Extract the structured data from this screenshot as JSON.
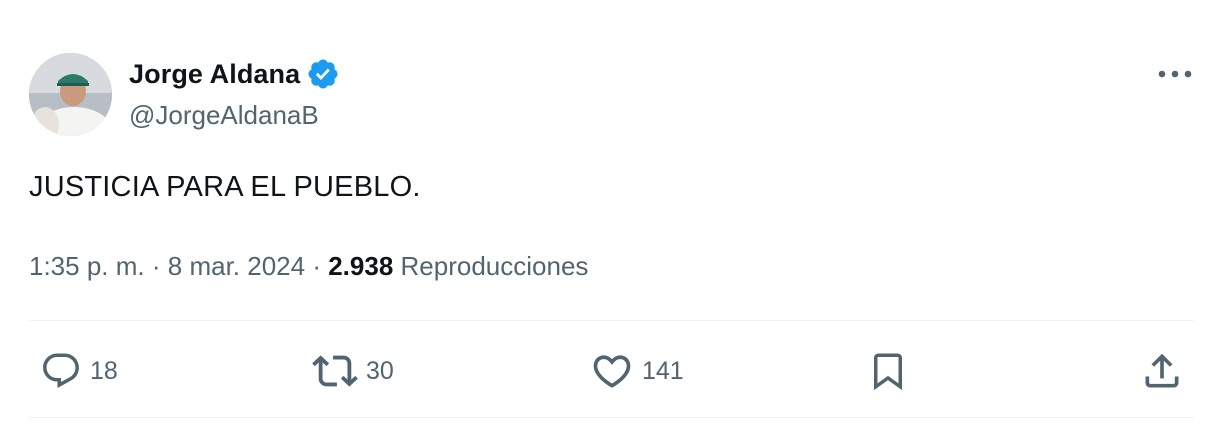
{
  "author": {
    "name": "Jorge Aldana",
    "handle": "@JorgeAldanaB",
    "verified": true,
    "verified_color": "#1d9bf0"
  },
  "tweet": {
    "text": "JUSTICIA PARA EL PUEBLO.",
    "time": "1:35 p. m.",
    "date": "8 mar. 2024",
    "separator": "·",
    "views_count": "2.938",
    "views_label": "Reproducciones"
  },
  "actions": {
    "replies": "18",
    "retweets": "30",
    "likes": "141"
  },
  "icons": {
    "more": "more-horizontal-icon",
    "reply": "reply-bubble-icon",
    "retweet": "retweet-icon",
    "like": "heart-icon",
    "bookmark": "bookmark-icon",
    "share": "share-upload-icon"
  },
  "colors": {
    "text_primary": "#0f1419",
    "text_secondary": "#536471",
    "divider": "#eff3f4"
  }
}
